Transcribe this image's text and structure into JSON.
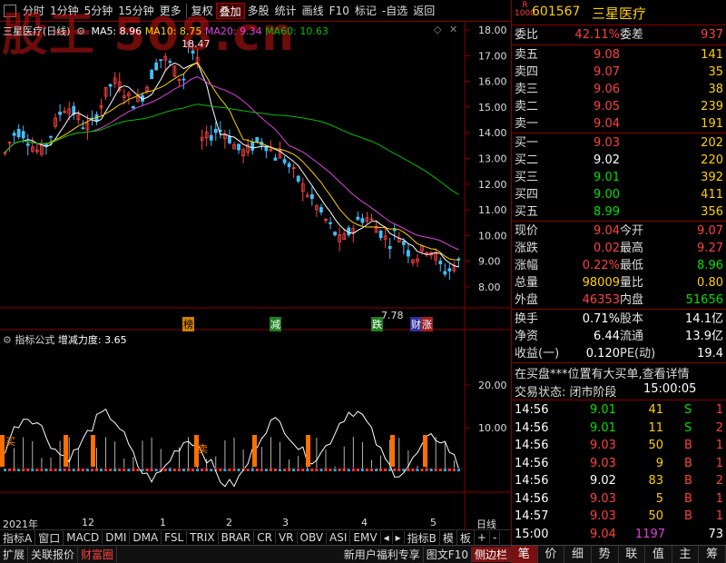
{
  "toolbar": {
    "items": [
      "分时",
      "1分钟",
      "5分钟",
      "15分钟",
      "更多",
      "复权",
      "叠加",
      "多股",
      "统计",
      "画线",
      "F10",
      "标记",
      "-自选",
      "返回"
    ],
    "active_index": 6
  },
  "watermark": "股王 508.cn",
  "chart_header": {
    "title": "三星医疗(日线)",
    "ma5": "MA5: 8.96",
    "ma10": "MA10: 8.75",
    "ma20": "MA20: 9.34",
    "ma60": "MA60: 10.63",
    "high_label": "18.47",
    "low_label": "7.78"
  },
  "price_axis": [
    "18.00",
    "17.00",
    "16.00",
    "15.00",
    "14.00",
    "13.00",
    "12.00",
    "11.00",
    "10.00",
    "9.00",
    "8.00"
  ],
  "event_tags": [
    "榜",
    "减",
    "跌",
    "财",
    "涨"
  ],
  "indicator": {
    "name": "指标公式",
    "label": "增减力度: 3.65",
    "axis": [
      "20.00",
      "10.00"
    ],
    "tags": [
      "买",
      "卖"
    ]
  },
  "time_axis": [
    "2021年",
    "12",
    "1",
    "2",
    "3",
    "4",
    "5"
  ],
  "time_axis_right": "日线",
  "bottom_tabs": [
    "指标A",
    "窗口",
    "MACD",
    "DMI",
    "DMA",
    "FSL",
    "TRIX",
    "BRAR",
    "CR",
    "VR",
    "OBV",
    "ASI",
    "EMV"
  ],
  "bottom_right_tabs": [
    "指标B",
    "模",
    "板",
    "+",
    "-"
  ],
  "status_bar": [
    "扩展",
    "关联报价",
    "财富圈"
  ],
  "status_bar_right": [
    "新用户福利专享",
    "图文F10",
    "侧边栏"
  ],
  "stock": {
    "code": "601567",
    "name": "三星医疗",
    "tag_top": "R",
    "tag_bottom": "1000"
  },
  "quote": {
    "weibi_label": "委比",
    "weibi": "42.11%",
    "weicha_label": "委差",
    "weicha": "937",
    "asks": [
      {
        "label": "卖五",
        "price": "9.08",
        "vol": "141"
      },
      {
        "label": "卖四",
        "price": "9.07",
        "vol": "35"
      },
      {
        "label": "卖三",
        "price": "9.06",
        "vol": "38"
      },
      {
        "label": "卖二",
        "price": "9.05",
        "vol": "239"
      },
      {
        "label": "卖一",
        "price": "9.04",
        "vol": "191"
      }
    ],
    "bids": [
      {
        "label": "买一",
        "price": "9.03",
        "vol": "202",
        "color": "red"
      },
      {
        "label": "买二",
        "price": "9.02",
        "vol": "220",
        "color": "wht"
      },
      {
        "label": "买三",
        "price": "9.01",
        "vol": "392",
        "color": "grn"
      },
      {
        "label": "买四",
        "price": "9.00",
        "vol": "411",
        "color": "grn"
      },
      {
        "label": "买五",
        "price": "8.99",
        "vol": "356",
        "color": "grn"
      }
    ],
    "stats": [
      {
        "l1": "现价",
        "v1": "9.04",
        "c1": "red",
        "l2": "今开",
        "v2": "9.07",
        "c2": "red"
      },
      {
        "l1": "涨跌",
        "v1": "0.02",
        "c1": "red",
        "l2": "最高",
        "v2": "9.27",
        "c2": "red"
      },
      {
        "l1": "涨幅",
        "v1": "0.22%",
        "c1": "red",
        "l2": "最低",
        "v2": "8.96",
        "c2": "grn"
      },
      {
        "l1": "总量",
        "v1": "98009",
        "c1": "yel",
        "l2": "量比",
        "v2": "0.80",
        "c2": "yel"
      },
      {
        "l1": "外盘",
        "v1": "46353",
        "c1": "red",
        "l2": "内盘",
        "v2": "51656",
        "c2": "grn"
      }
    ],
    "stats2": [
      {
        "l1": "换手",
        "v1": "0.71%",
        "l2": "股本",
        "v2": "14.1亿"
      },
      {
        "l1": "净资",
        "v1": "6.44",
        "l2": "流通",
        "v2": "13.9亿"
      },
      {
        "l1": "收益(一)",
        "v1": "0.120",
        "l2": "PE(动)",
        "v2": "19.4"
      }
    ],
    "notice": "在买盘***位置有大买单,查看详情",
    "trade_state": "交易状态: 闭市阶段",
    "trade_time": "15:00:05"
  },
  "ticks": [
    {
      "t": "14:56",
      "p": "9.01",
      "pc": "grn",
      "v": "41",
      "d": "S",
      "dc": "grn"
    },
    {
      "t": "14:56",
      "p": "9.01",
      "pc": "grn",
      "v": "11",
      "d": "S",
      "dc": "grn"
    },
    {
      "t": "14:56",
      "p": "9.03",
      "pc": "red",
      "v": "50",
      "d": "B",
      "dc": "red"
    },
    {
      "t": "14:56",
      "p": "9.03",
      "pc": "red",
      "v": "9",
      "d": "B",
      "dc": "red"
    },
    {
      "t": "14:56",
      "p": "9.02",
      "pc": "wht",
      "v": "83",
      "d": "B",
      "dc": "red"
    },
    {
      "t": "14:56",
      "p": "9.03",
      "pc": "red",
      "v": "5",
      "d": "B",
      "dc": "red"
    },
    {
      "t": "14:57",
      "p": "9.03",
      "pc": "red",
      "v": "50",
      "d": "B",
      "dc": "red"
    },
    {
      "t": "15:00",
      "p": "9.04",
      "pc": "red",
      "v": "1197",
      "d": "",
      "dc": "",
      "extra": "73"
    }
  ],
  "ticks_extra": [
    "1",
    "2",
    "1",
    "1",
    "2",
    "1",
    "1"
  ],
  "right_bottom_tabs": [
    "笔",
    "价",
    "细",
    "势",
    "联",
    "值",
    "主",
    "筹"
  ],
  "colors": {
    "up": "#ff4040",
    "down": "#00e000",
    "ma5": "#ffffff",
    "ma10": "#ffd000",
    "ma20": "#e040e0",
    "ma60": "#00c000",
    "frame": "#8b0000"
  }
}
